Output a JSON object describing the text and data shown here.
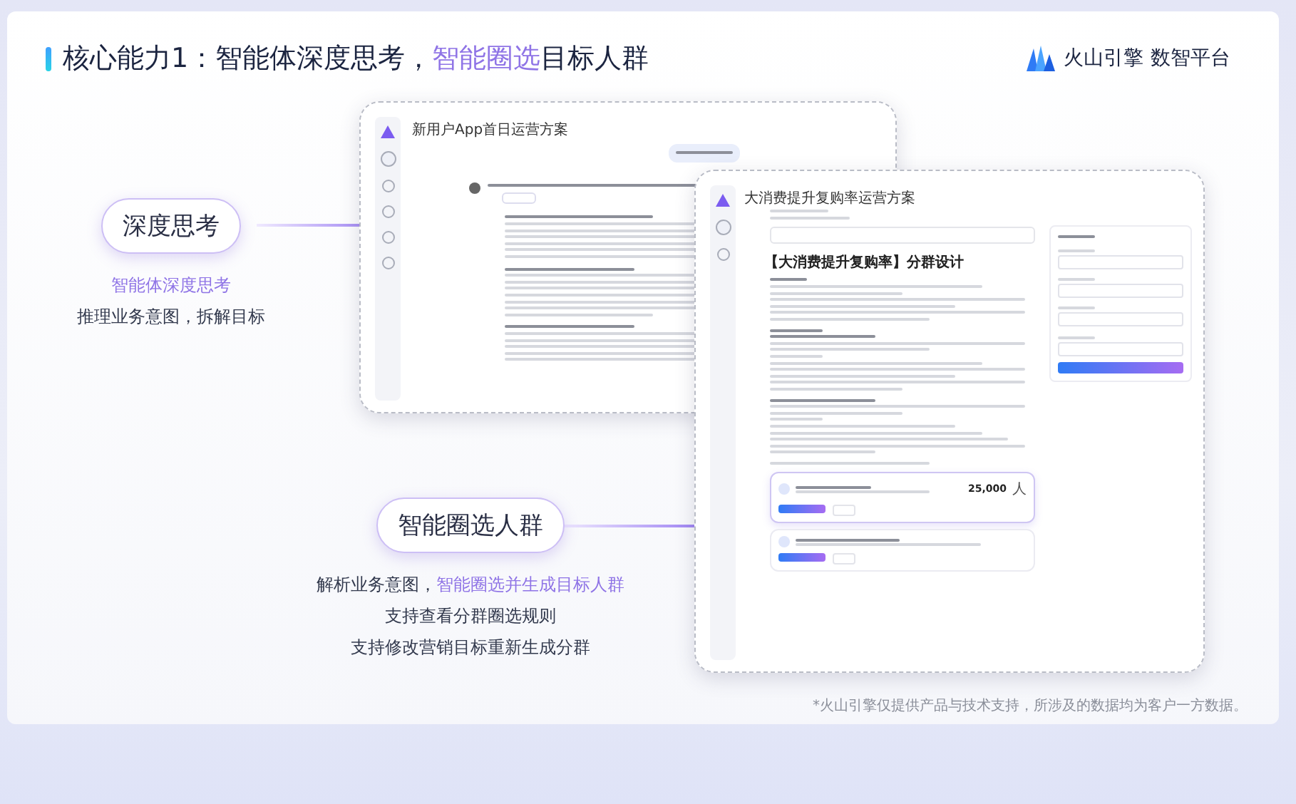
{
  "title": [
    {
      "text": "核心能力1：智能体深度思考，",
      "highlight": false
    },
    {
      "text": "智能圈选",
      "highlight": true
    },
    {
      "text": "目标人群",
      "highlight": false
    }
  ],
  "logo": {
    "brand": "火山引擎",
    "product": "数智平台"
  },
  "callouts": [
    {
      "pill": "深度思考",
      "lines": [
        [
          {
            "text": "智能体深度思考",
            "highlight": true
          }
        ],
        [
          {
            "text": "推理业务意图，拆解目标",
            "highlight": false
          }
        ]
      ]
    },
    {
      "pill": "智能圈选人群",
      "lines": [
        [
          {
            "text": "解析业务意图，",
            "highlight": false
          },
          {
            "text": "智能圈选并生成目标人群",
            "highlight": true
          }
        ],
        [
          {
            "text": "支持查看分群圈选规则",
            "highlight": false
          }
        ],
        [
          {
            "text": "支持修改营销目标重新生成分群",
            "highlight": false
          }
        ]
      ]
    }
  ],
  "windows": [
    {
      "title": "新用户App首日运营方案"
    },
    {
      "title": "大消费提升复购率运营方案",
      "heading": "【大消费提升复购率】分群设计",
      "segments": [
        {
          "count": "25,000",
          "unit": "人"
        }
      ]
    }
  ],
  "footnote": "*火山引擎仅提供产品与技术支持，所涉及的数据均为客户一方数据。"
}
